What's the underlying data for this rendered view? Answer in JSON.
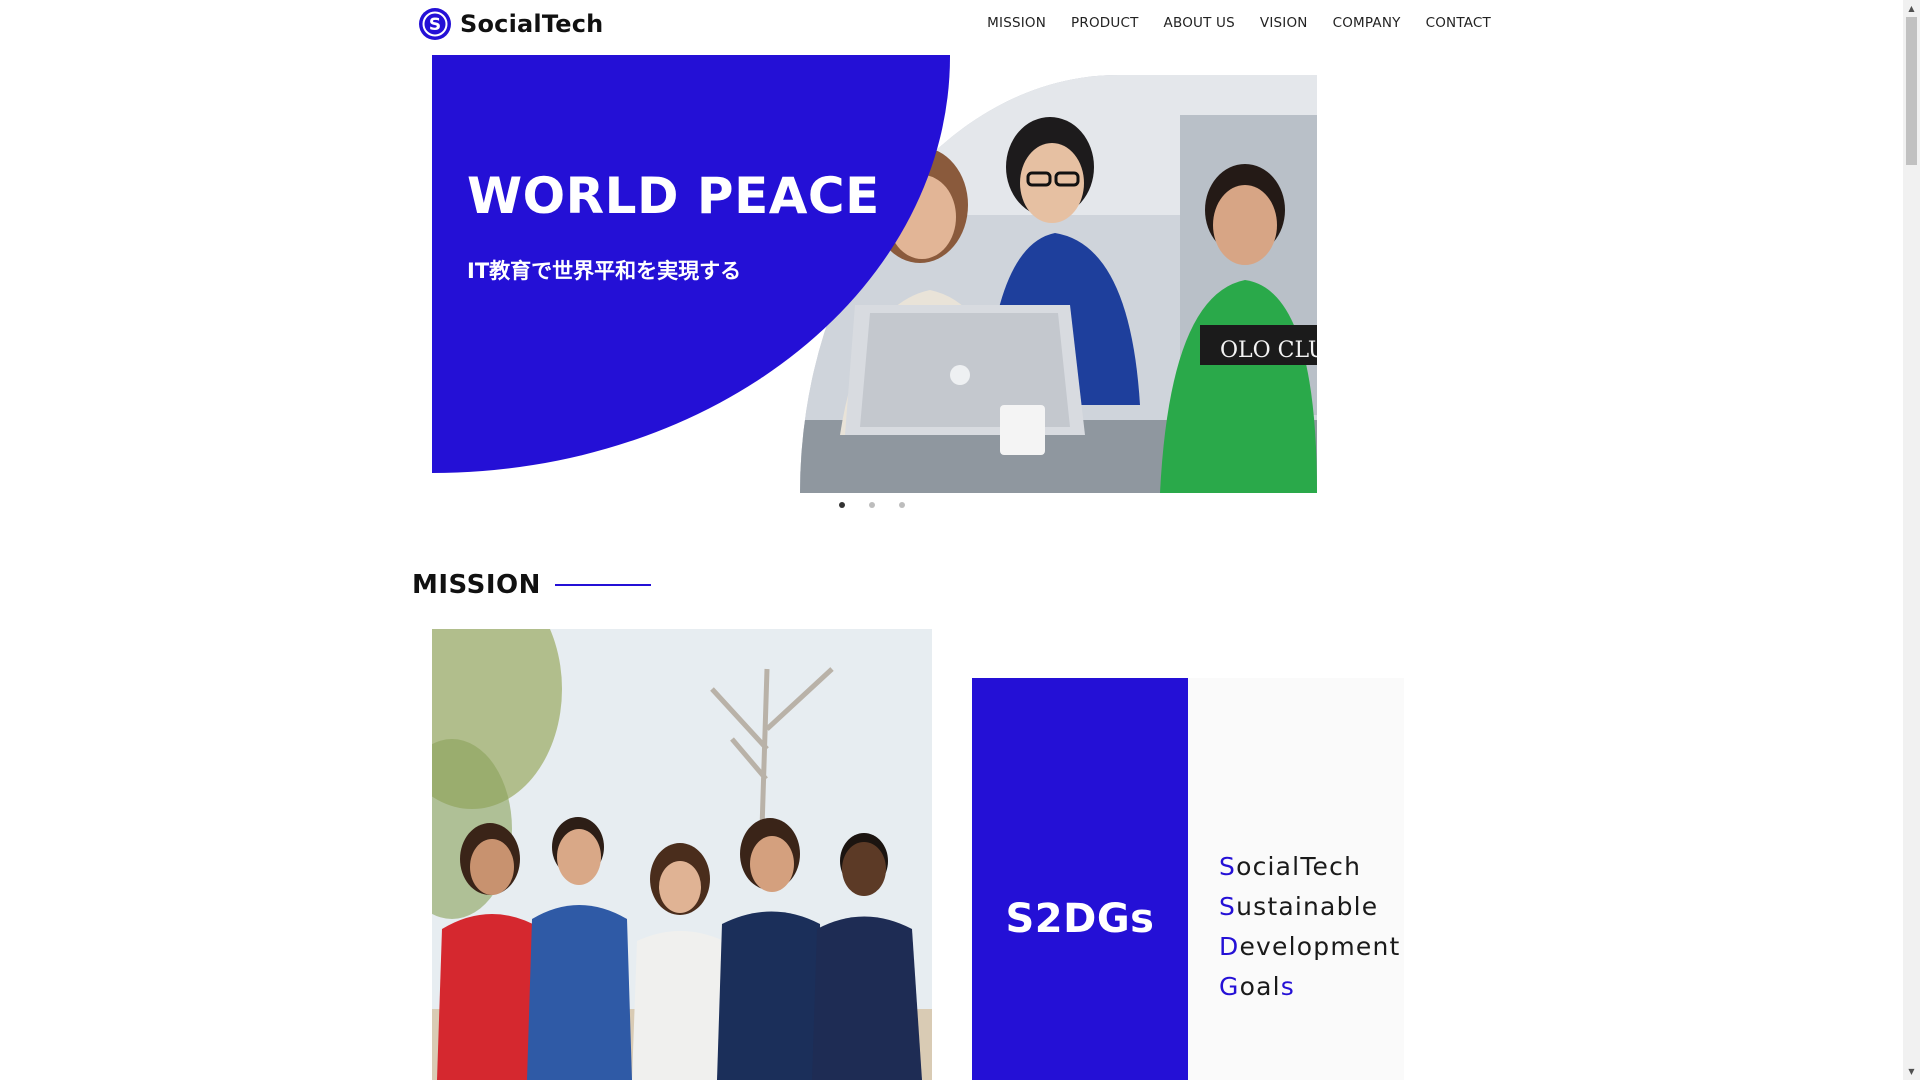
{
  "brand": {
    "name": "SocialTech",
    "logo_letter": "S",
    "logo_icon": "s-logo-icon"
  },
  "nav": {
    "items": [
      {
        "label": "MISSION"
      },
      {
        "label": "PRODUCT"
      },
      {
        "label": "ABOUT US"
      },
      {
        "label": "VISION"
      },
      {
        "label": "COMPANY"
      },
      {
        "label": "CONTACT"
      }
    ]
  },
  "hero": {
    "title": "WORLD PEACE",
    "subtitle": "IT教育で世界平和を実現する",
    "photo": "team-working-at-laptop-photo",
    "slides": {
      "count": 3,
      "active": 1
    }
  },
  "mission": {
    "heading": "MISSION",
    "photo": "group-of-friends-sitting-photo",
    "card": {
      "title": "S2DGs",
      "lines": [
        {
          "accent": "S",
          "rest": "ocialTech",
          "tail": ""
        },
        {
          "accent": "S",
          "rest": "ustainable",
          "tail": ""
        },
        {
          "accent": "D",
          "rest": "evelopment",
          "tail": ""
        },
        {
          "accent": "G",
          "rest": "oal",
          "tail": "s"
        }
      ]
    }
  },
  "colors": {
    "brand_blue": "#2410d6",
    "text": "#111111",
    "card_bg": "#fafafa",
    "dot_active": "#333333",
    "dot_inactive": "#bdbdbd"
  }
}
